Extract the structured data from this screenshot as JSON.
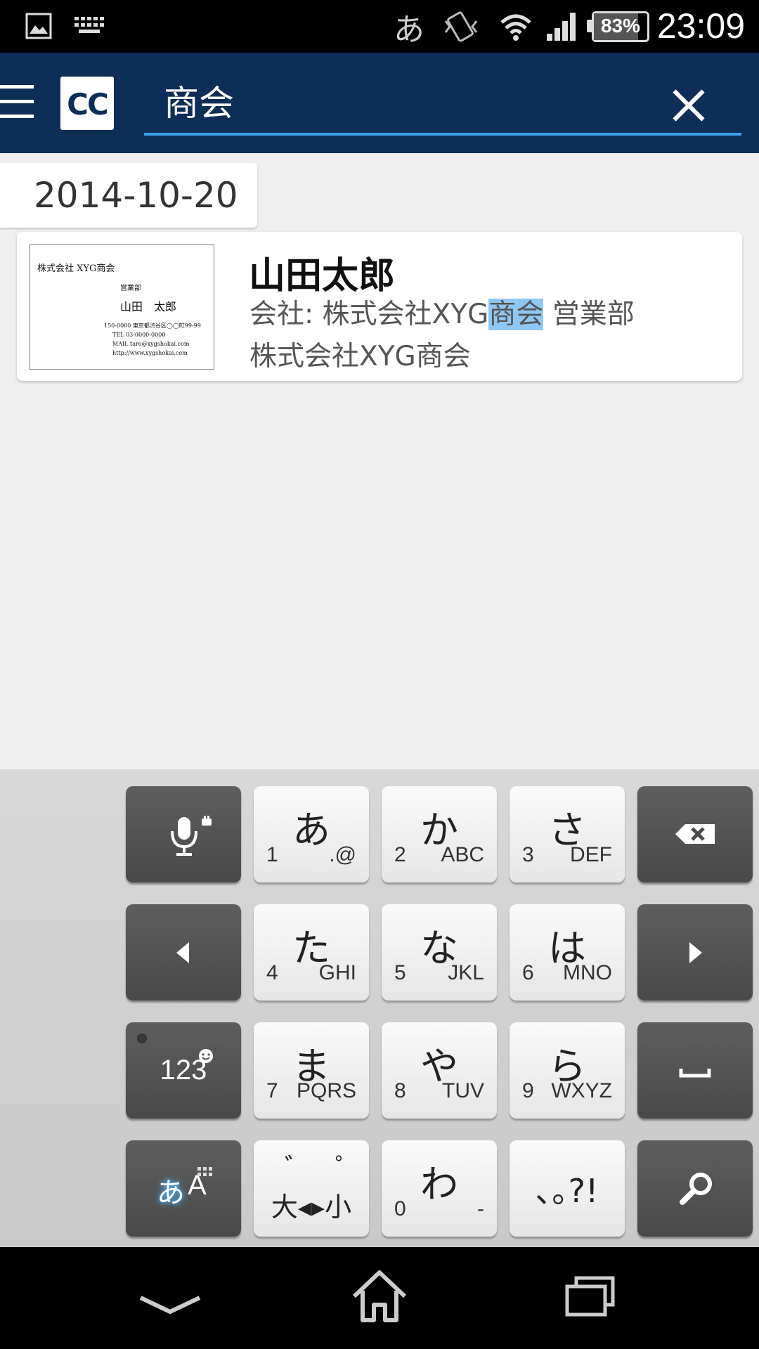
{
  "status_bar": {
    "ime_indicator": "あ",
    "battery": "83%",
    "battery_level": 0.83,
    "time": "23:09",
    "icons": [
      "image-icon",
      "keyboard-icon",
      "ime-icon",
      "vibrate-icon",
      "wifi-icon",
      "signal-icon",
      "battery-icon"
    ]
  },
  "app_bar": {
    "logo": "CC",
    "search_value": "商会",
    "accent_color": "#0d2e57",
    "underline_color": "#3da0e8"
  },
  "results": {
    "date_header": "2014-10-20",
    "card": {
      "name": "山田太郎",
      "company_prefix": "会社: 株式会社XYG",
      "company_highlight": "商会",
      "company_suffix": " 営業部",
      "company_line2": "株式会社XYG商会",
      "thumbnail": {
        "company": "株式会社 XYG商会",
        "department": "営業部",
        "person": "山田　太郎",
        "details": [
          "150-0000 東京都渋谷区◯◯町99-99",
          "TEL  03-0000-0000",
          "MAIL  taro@xygshokai.com",
          "http://www.xygshokai.com"
        ]
      }
    }
  },
  "keyboard": {
    "keys": [
      {
        "kana": "あ",
        "num": "1",
        "alpha": ".@"
      },
      {
        "kana": "か",
        "num": "2",
        "alpha": "ABC"
      },
      {
        "kana": "さ",
        "num": "3",
        "alpha": "DEF"
      },
      {
        "kana": "た",
        "num": "4",
        "alpha": "GHI"
      },
      {
        "kana": "な",
        "num": "5",
        "alpha": "JKL"
      },
      {
        "kana": "は",
        "num": "6",
        "alpha": "MNO"
      },
      {
        "kana": "ま",
        "num": "7",
        "alpha": "PQRS"
      },
      {
        "kana": "や",
        "num": "8",
        "alpha": "TUV"
      },
      {
        "kana": "ら",
        "num": "9",
        "alpha": "WXYZ"
      },
      {
        "kana": "わ",
        "num": "0",
        "alpha": "-"
      }
    ],
    "numeric_mode": "123",
    "dakuten": "゛゜",
    "dakuten_label": "大◂▸小",
    "punctuation": "､｡?!",
    "lang_kana": "あ",
    "lang_alpha": "A"
  },
  "nav_bar": {
    "icons": [
      "back-icon",
      "home-icon",
      "recents-icon"
    ]
  }
}
